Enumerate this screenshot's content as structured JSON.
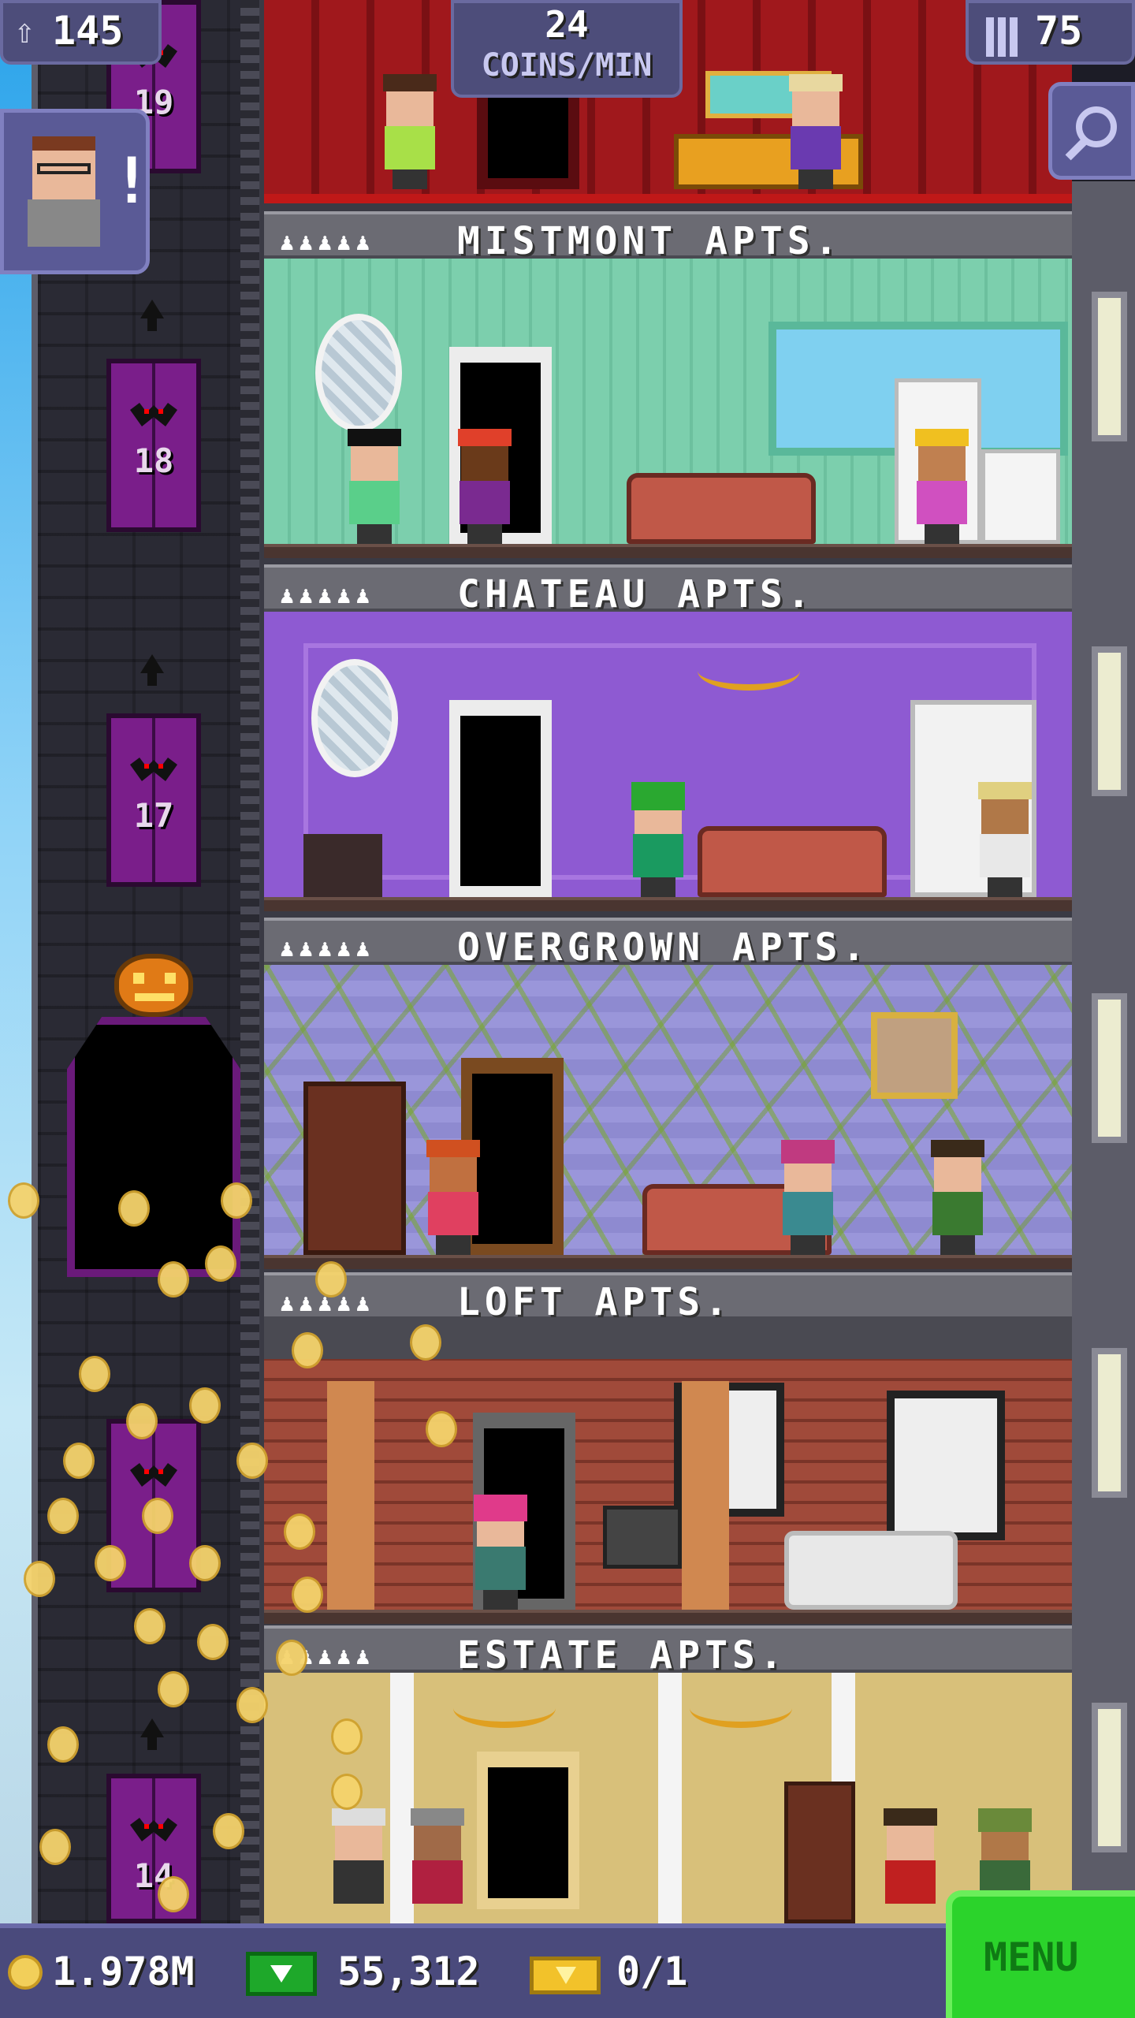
{
  "hud": {
    "population": "145",
    "coins_per_min_value": "24",
    "coins_per_min_unit": "COINS/MIN",
    "floors": "75",
    "notification": "!"
  },
  "shaft": {
    "elevator_floors": [
      "19",
      "18",
      "17",
      "14"
    ]
  },
  "floors": [
    {
      "name": "MISTMONT APTS.",
      "people": "♟♟♟♟♟"
    },
    {
      "name": "CHATEAU APTS.",
      "people": "♟♟♟♟♟"
    },
    {
      "name": "OVERGROWN APTS.",
      "people": "♟♟♟♟♟"
    },
    {
      "name": "LOFT APTS.",
      "people": "♟♟♟♟♟"
    },
    {
      "name": "ESTATE APTS.",
      "people": "♟♟♟♟♟"
    }
  ],
  "bottom": {
    "coins": "1.978M",
    "bux": "55,312",
    "tickets": "0/1",
    "menu_label": "MENU"
  },
  "colors": {
    "hud_pill": "#4d4d7a",
    "menu_green": "#2bd32b",
    "elevator_purple": "#7a1e8a"
  },
  "icons": {
    "population": "person-up-icon",
    "floors": "building-icon",
    "search": "magnifier-icon",
    "coins": "coin-icon",
    "bux": "bux-bill-icon",
    "tickets": "golden-ticket-icon"
  }
}
